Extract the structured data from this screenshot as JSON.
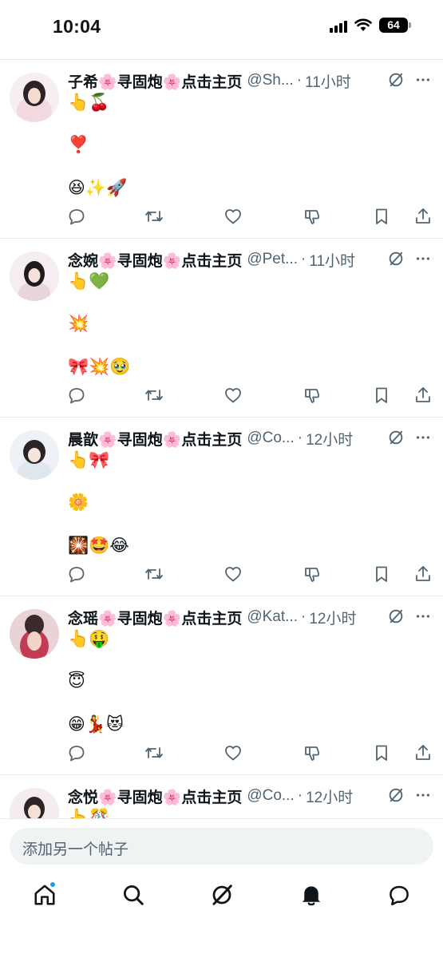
{
  "status_bar": {
    "time": "10:04",
    "battery": "64"
  },
  "posts": [
    {
      "name": "子希🌸寻固炮🌸点击主页",
      "handle": "@Sh...",
      "time": "11小时",
      "line1": "👆🍒",
      "line2": "❣️",
      "line3": "😆✨🚀"
    },
    {
      "name": "念婉🌸寻固炮🌸点击主页",
      "handle": "@Pet...",
      "time": "11小时",
      "line1": "👆💚",
      "line2": "💥",
      "line3": "🎀💥🥹"
    },
    {
      "name": "晨歆🌸寻固炮🌸点击主页",
      "handle": "@Co...",
      "time": "12小时",
      "line1": "👆🎀",
      "line2": "🌼",
      "line3": "🎇🤩😂"
    },
    {
      "name": "念瑶🌸寻固炮🌸点击主页",
      "handle": "@Kat...",
      "time": "12小时",
      "line1": "👆🤑",
      "line2": "😇",
      "line3": "😁💃😻"
    },
    {
      "name": "念悦🌸寻固炮🌸点击主页",
      "handle": "@Co...",
      "time": "12小时",
      "line1": "👆🎊",
      "line2": "",
      "line3": ""
    }
  ],
  "compose": {
    "placeholder": "添加另一个帖子"
  },
  "nav": {
    "items": [
      "home-icon",
      "search-icon",
      "grok-icon",
      "notifications-icon",
      "messages-icon"
    ]
  },
  "colors": {
    "accent": "#1d9bf0",
    "text": "#0f1419",
    "secondary": "#536471"
  }
}
